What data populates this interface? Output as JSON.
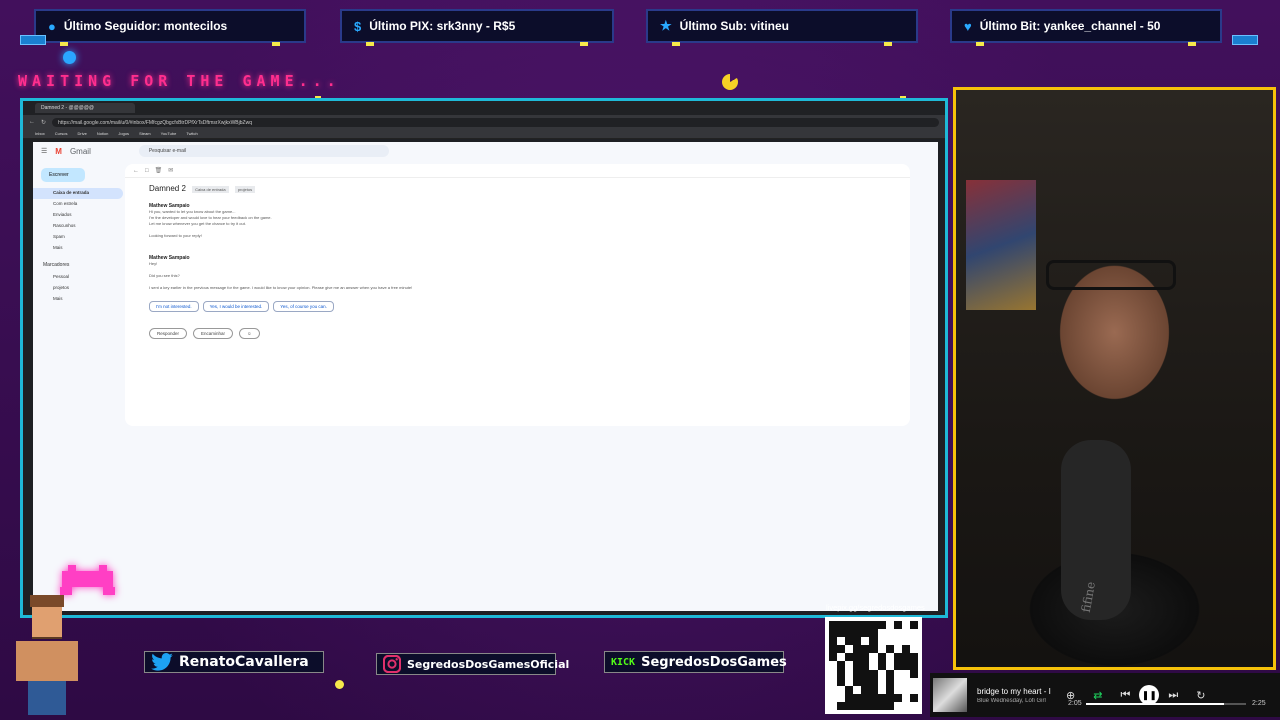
{
  "alerts": [
    {
      "label": "Último Seguidor: montecilos",
      "icon": "user-icon"
    },
    {
      "label": "Último PIX: srk3nny - R$5",
      "icon": "dollar-icon"
    },
    {
      "label": "Último Sub: vitineu",
      "icon": "star-icon"
    },
    {
      "label": "Último Bit: yankee_channel - 50",
      "icon": "diamond-icon"
    }
  ],
  "overlay": {
    "waiting_text": "WAITING FOR THE GAME..."
  },
  "browser": {
    "tab_title": "Damned 2 - @@@@@",
    "url": "https://mail.google.com/mail/u/0/#inbox/FMfcgzQbgcfxBtrDPfXrTsDftmsrXwjkxWBjbZwq",
    "bookmarks": [
      "Inbox",
      "Cursos",
      "Drive",
      "Notion",
      "Jogos",
      "Steam",
      "YouTube",
      "Twitch"
    ]
  },
  "gmail": {
    "logo": "Gmail",
    "search_placeholder": "Pesquisar e-mail",
    "compose": "Escrever",
    "side_items": [
      "Caixa de entrada",
      "Com estrela",
      "Enviados",
      "Rascunhos",
      "Spam",
      "Mais"
    ],
    "labels_title": "Marcadores",
    "labels": [
      "Pessoal",
      "projetos",
      "Mais"
    ],
    "subject": "Damned 2",
    "subject_tags": [
      "Caixa de entrada",
      "projetos"
    ],
    "message1_from": "Mathew Sampaio",
    "message1_lines": [
      "Hi you, wanted to let you know about the game...",
      "I'm the developer and would love to hear your feedback on the game.",
      "Let me know whenever you get the chance to try it out."
    ],
    "message1_sign": "Looking forward to your reply!",
    "message2_from": "Mathew Sampaio",
    "message2_lines": [
      "Hey!",
      "Did you see this?",
      "I sent a key earlier in the previous message for the game. I would like to know your opinion. Please give me an answer when you have a free minute!"
    ],
    "smart_replies": [
      "I'm not interested.",
      "Yes, I would be interested.",
      "Yes, of course you can."
    ],
    "reply": "Responder",
    "forward": "Encaminhar"
  },
  "socials": [
    {
      "name": "RenatoCavallera",
      "icon": "twitter-icon",
      "color": "#1da1f2"
    },
    {
      "name": "SegredosDosGamesOficial",
      "icon": "instagram-icon",
      "color": "#e1306c"
    },
    {
      "name": "SegredosDosGames",
      "icon": "kick-icon",
      "color": "#53fc18",
      "icon_text": "KICK"
    }
  ],
  "qr": {
    "url": "livepix.gg/segredosdosgames"
  },
  "music": {
    "title": "bridge to my heart - I",
    "artist": "Blue Wednesday, Lofi Girl",
    "elapsed": "2:05",
    "duration": "2:25",
    "progress": 0.86
  },
  "colors": {
    "background": "#3a0e52",
    "accent_cyan": "#1fb9d8",
    "webcam_border": "#f6c20a",
    "waiting_text": "#ff2e8e"
  }
}
